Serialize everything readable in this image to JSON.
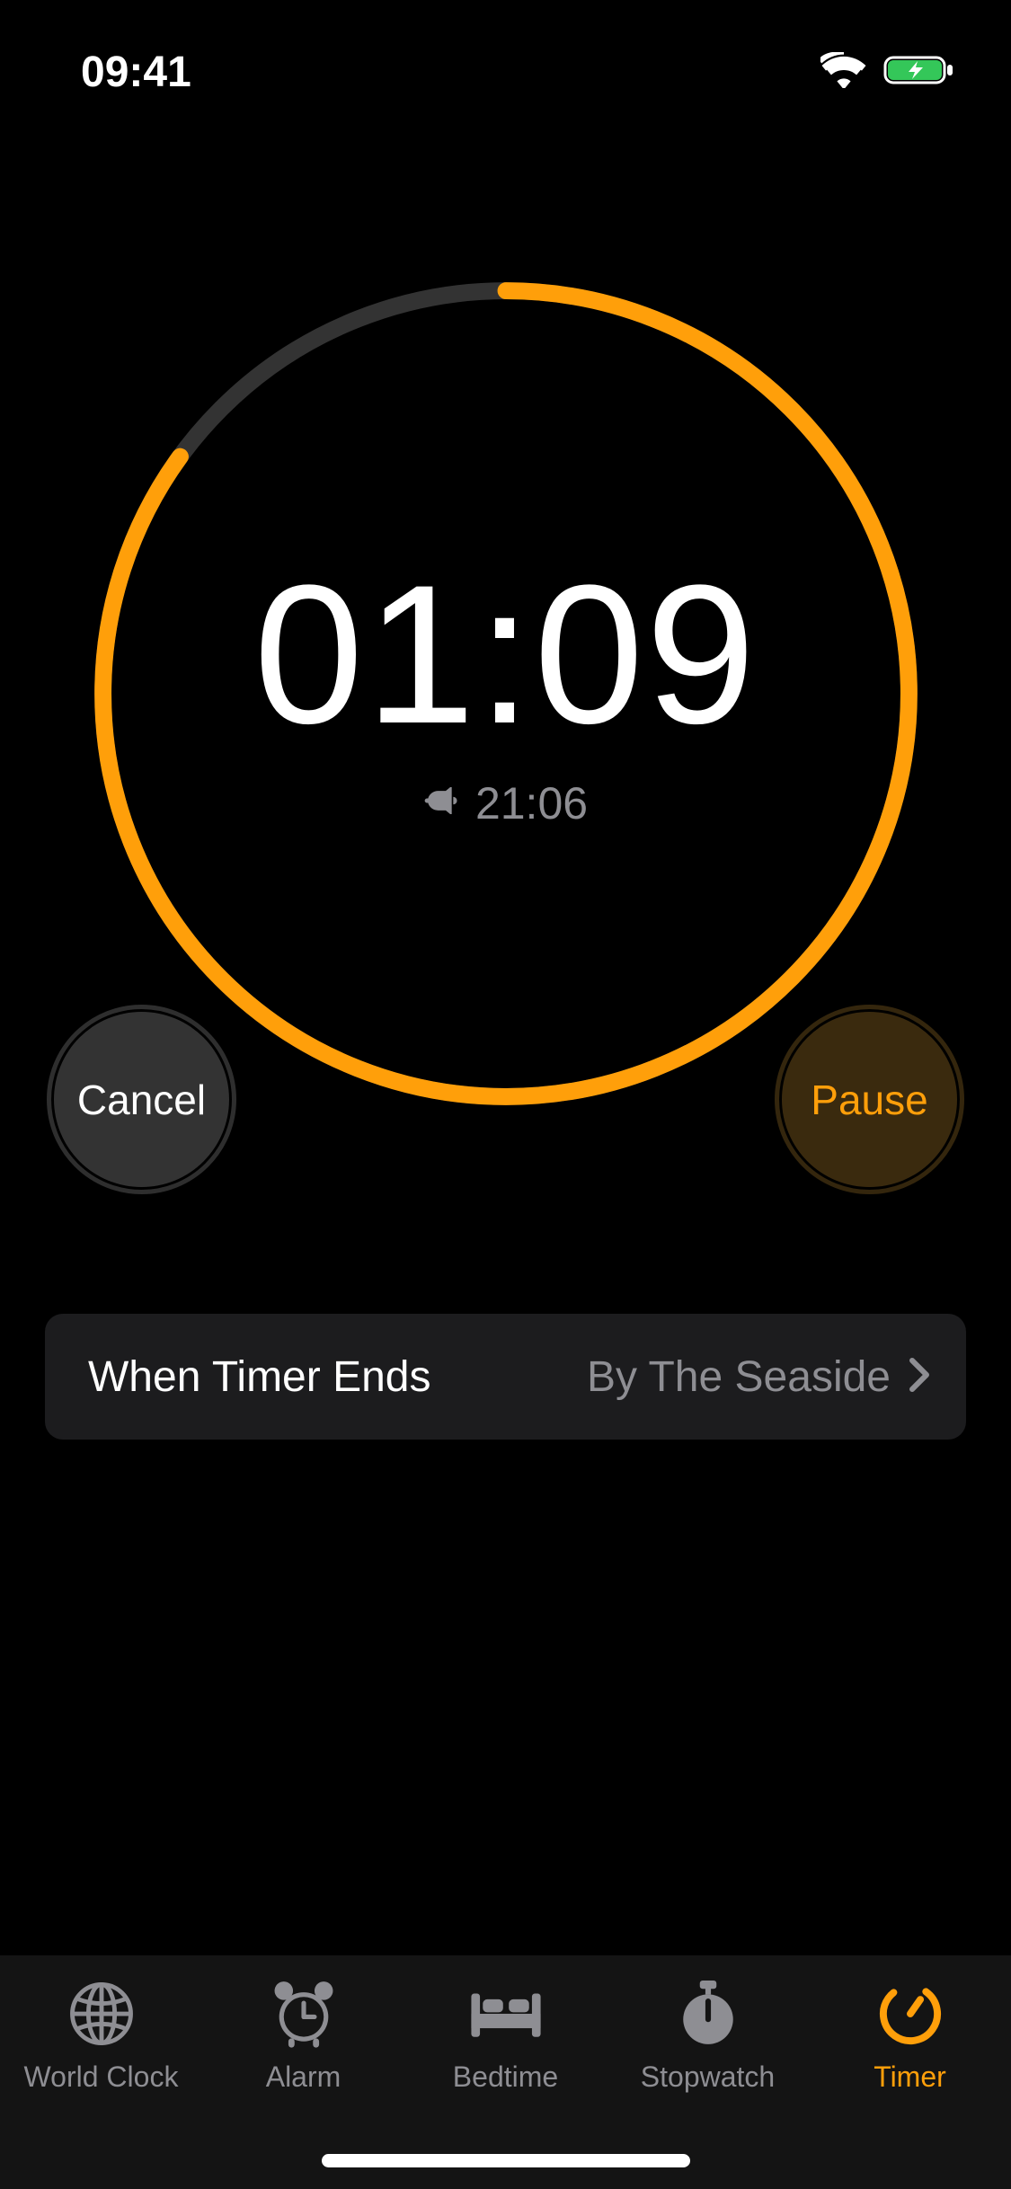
{
  "status": {
    "time": "09:41"
  },
  "timer": {
    "remaining": "01:09",
    "end_time": "21:06",
    "progress_remaining": 0.85
  },
  "buttons": {
    "cancel": "Cancel",
    "pause": "Pause"
  },
  "ends": {
    "label": "When Timer Ends",
    "value": "By The Seaside"
  },
  "tabs": {
    "world_clock": "World Clock",
    "alarm": "Alarm",
    "bedtime": "Bedtime",
    "stopwatch": "Stopwatch",
    "timer": "Timer"
  },
  "colors": {
    "accent": "#ff9f0a",
    "gray": "#8e8e93",
    "track": "#333333"
  }
}
